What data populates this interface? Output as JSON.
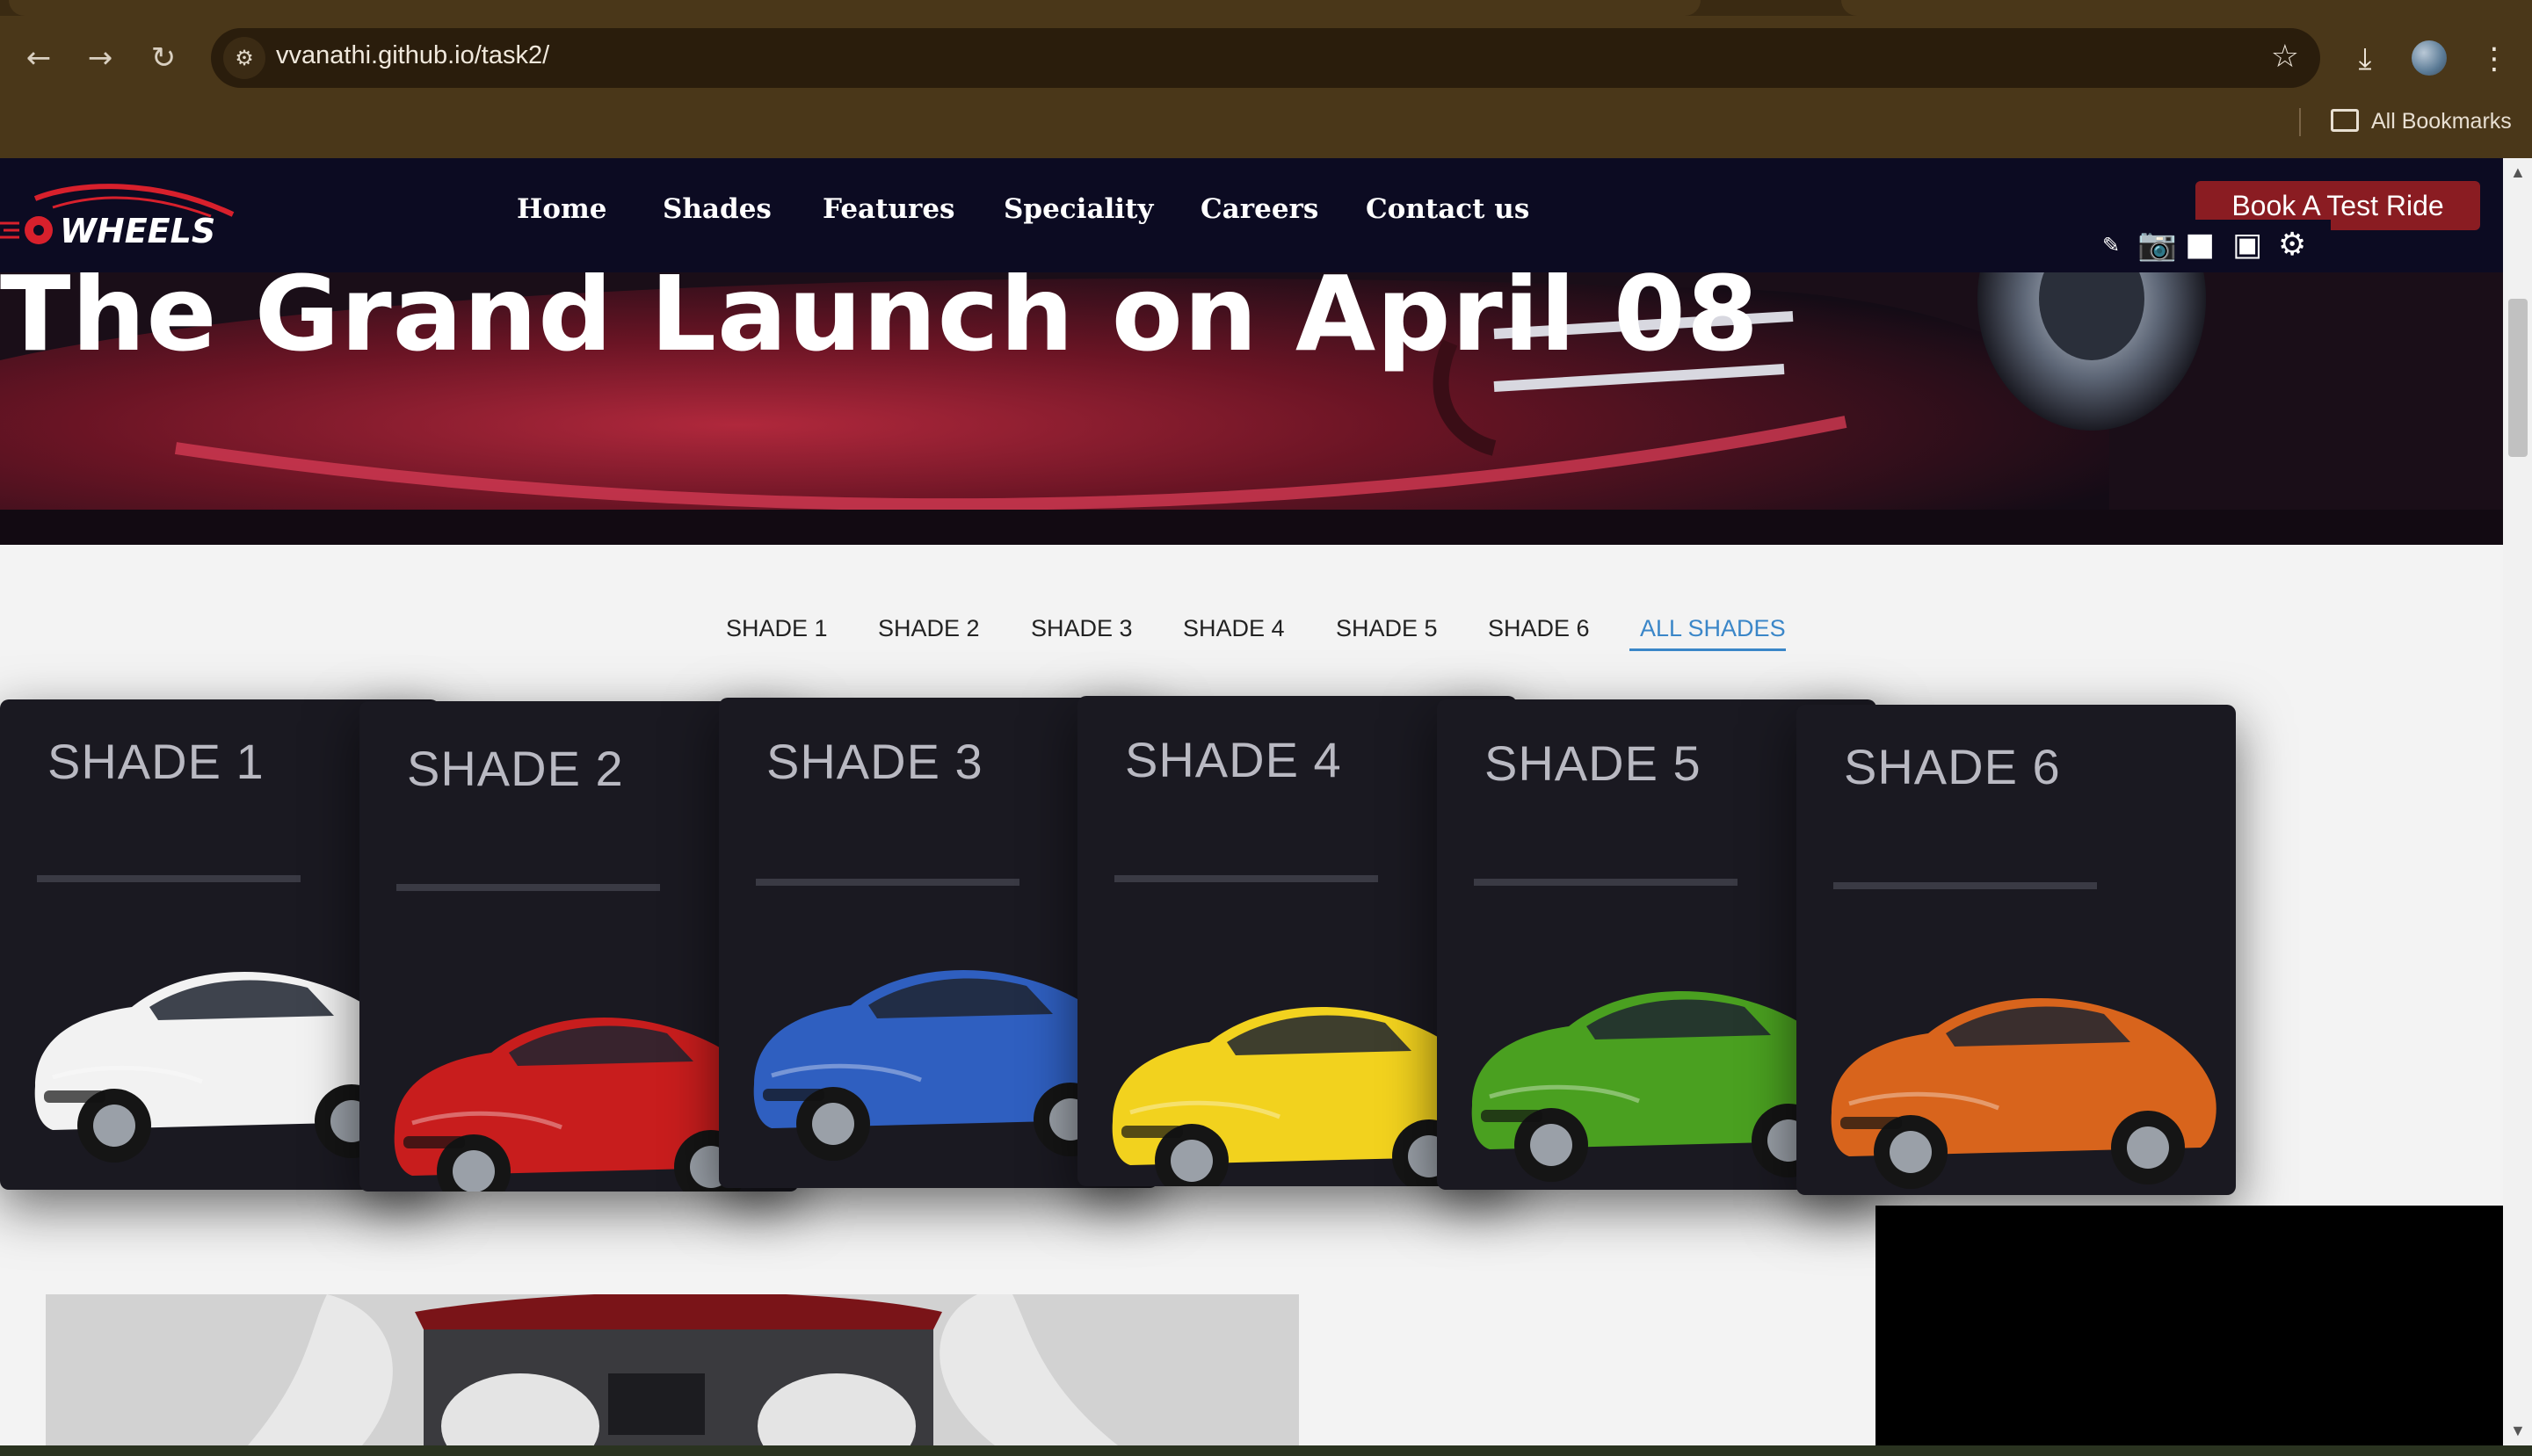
{
  "browser": {
    "url": "vvanathi.github.io/task2/",
    "bookmarks_label": "All Bookmarks",
    "icons": [
      "back-arrow-icon",
      "forward-arrow-icon",
      "reload-icon",
      "site-info-icon",
      "star-icon",
      "download-icon",
      "profile-avatar",
      "menu-dots-icon",
      "folder-icon"
    ]
  },
  "navbar": {
    "logo_text": "WHEELS",
    "links": [
      "Home",
      "Shades",
      "Features",
      "Speciality",
      "Careers",
      "Contact us"
    ],
    "cta": "Book A Test Ride",
    "accent_color": "#8a1c22",
    "background_color": "#0c0b22"
  },
  "hero": {
    "headline": "The Grand Launch on April 08"
  },
  "shade_tabs": {
    "items": [
      "SHADE 1",
      "SHADE 2",
      "SHADE 3",
      "SHADE 4",
      "SHADE 5",
      "SHADE 6",
      "ALL SHADES"
    ],
    "active": "ALL SHADES",
    "active_color": "#3a86c8"
  },
  "cards": [
    {
      "title": "SHADE 1",
      "car_color": "#f2f2f2"
    },
    {
      "title": "SHADE 2",
      "car_color": "#c81d1d"
    },
    {
      "title": "SHADE 3",
      "car_color": "#2f5fc0"
    },
    {
      "title": "SHADE 4",
      "car_color": "#f2d21e"
    },
    {
      "title": "SHADE 5",
      "car_color": "#4aa020"
    },
    {
      "title": "SHADE 6",
      "car_color": "#d8641c"
    }
  ]
}
